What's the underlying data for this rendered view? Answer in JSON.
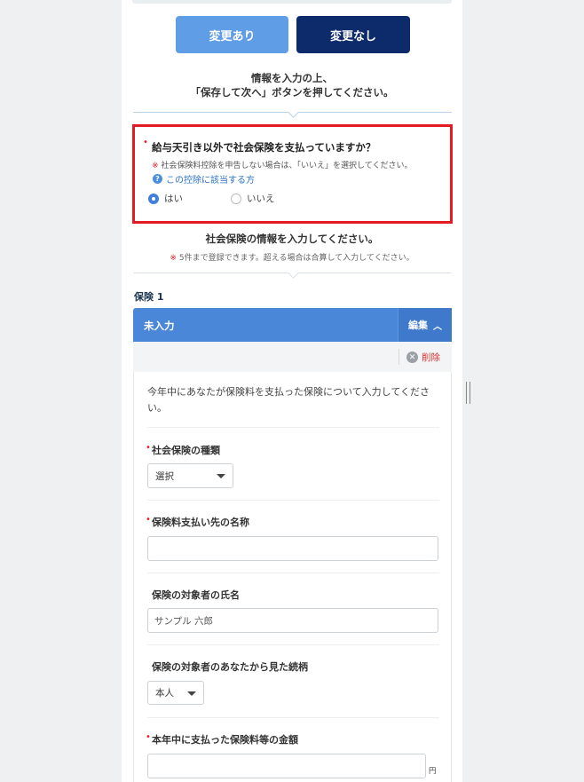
{
  "buttons": {
    "changed": "変更あり",
    "unchanged": "変更なし"
  },
  "instruction": {
    "line1": "情報を入力の上、",
    "line2": "「保存して次へ」ボタンを押してください。"
  },
  "question": {
    "required_mark": "•",
    "label": "給与天引き以外で社会保険を支払っていますか？",
    "note_mark": "※",
    "note": "社会保険料控除を申告しない場合は、「いいえ」を選択してください。",
    "help_icon": "?",
    "help_link": "この控除に該当する方",
    "options": [
      {
        "label": "はい",
        "selected": true
      },
      {
        "label": "いいえ",
        "selected": false
      }
    ]
  },
  "insurance_info": {
    "title": "社会保険の情報を入力してください。",
    "note_mark": "※",
    "note": "5件まで登録できます。超える場合は合算して入力してください。"
  },
  "insurance": {
    "heading": "保険 1",
    "status": "未入力",
    "edit_label": "編集",
    "edit_icon": "chevron-up-icon",
    "delete_label": "削除",
    "delete_icon": "close-circle-icon",
    "intro": "今年中にあなたが保険料を支払った保険について入力してください。",
    "fields": {
      "type": {
        "required": true,
        "label": "社会保険の種類",
        "value": "選択"
      },
      "payee": {
        "required": true,
        "label": "保険料支払い先の名称",
        "value": ""
      },
      "insured_name": {
        "required": false,
        "label": "保険の対象者の氏名",
        "value": "サンプル 六郎"
      },
      "relationship": {
        "required": false,
        "label": "保険の対象者のあなたから見た続柄",
        "value": "本人"
      },
      "amount": {
        "required": true,
        "label": "本年中に支払った保険料等の金額",
        "value": "",
        "unit": "円"
      }
    }
  },
  "colors": {
    "accent": "#4b87d8",
    "primary_dark": "#0d2a6b",
    "highlight_border": "#e31b23",
    "delete": "#d33333"
  }
}
